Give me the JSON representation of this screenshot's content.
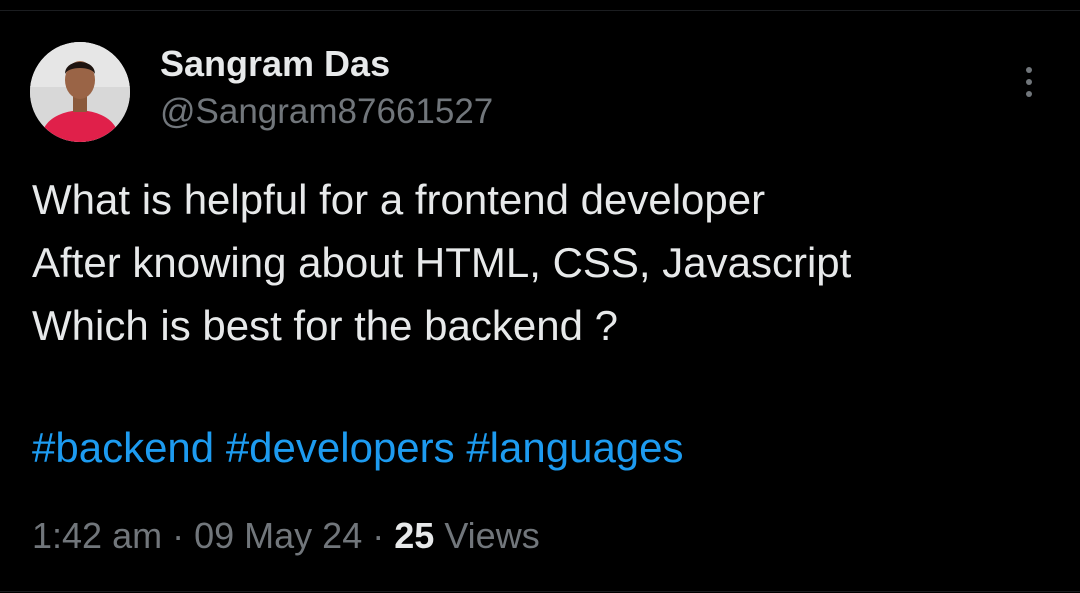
{
  "author": {
    "display_name": "Sangram Das",
    "handle": "@Sangram87661527"
  },
  "post": {
    "lines": [
      "What is helpful for a frontend developer",
      "After knowing about HTML, CSS, Javascript",
      "Which is best for the backend ?"
    ],
    "hashtags": [
      "#backend",
      "#developers",
      "#languages"
    ]
  },
  "meta": {
    "time": "1:42 am",
    "separator": "·",
    "date": "09 May 24",
    "views_count": "25",
    "views_label": "Views"
  },
  "icons": {
    "more": "more-vertical-icon"
  },
  "colors": {
    "background": "#000000",
    "text_primary": "#e7e9ea",
    "text_secondary": "#71767b",
    "link": "#1d9bf0",
    "avatar_shirt": "#e0204a"
  }
}
